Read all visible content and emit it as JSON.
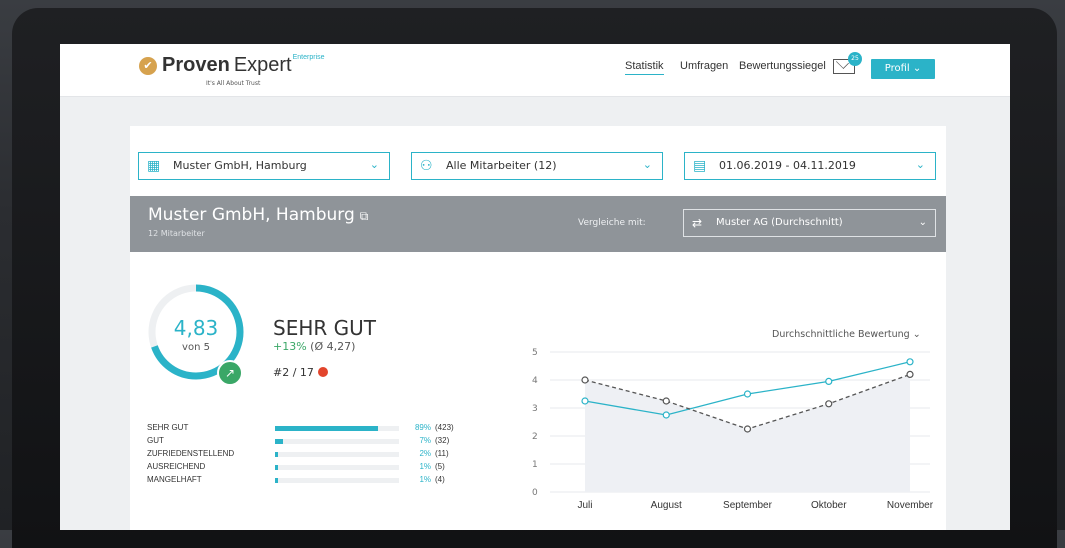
{
  "header": {
    "brand_bold": "Proven",
    "brand_light": "Expert",
    "brand_edition": "Enterprise",
    "tagline": "It's All About Trust",
    "nav": [
      {
        "label": "Statistik",
        "active": true
      },
      {
        "label": "Umfragen",
        "active": false
      },
      {
        "label": "Bewertungssiegel",
        "active": false
      }
    ],
    "mail_badge": "25",
    "profile_label": "Profil"
  },
  "filters": {
    "location": "Muster GmbH, Hamburg",
    "employees": "Alle Mitarbeiter (12)",
    "date_range": "01.06.2019 - 04.11.2019"
  },
  "company_bar": {
    "name": "Muster GmbH, Hamburg",
    "employees": "12 Mitarbeiter",
    "compare_label": "Vergleiche mit:",
    "compare_value": "Muster AG (Durchschnitt)"
  },
  "rating": {
    "value": "4,83",
    "of": "von 5",
    "grade": "SEHR GUT",
    "delta": "+13%",
    "avg": "(Ø 4,27)",
    "rank": "#2 / 17",
    "fraction": 0.966
  },
  "distribution": [
    {
      "label": "SEHR GUT",
      "pct": "89%",
      "count": "(423)",
      "share": 0.89
    },
    {
      "label": "GUT",
      "pct": "7%",
      "count": "(32)",
      "share": 0.07
    },
    {
      "label": "ZUFRIEDENSTELLEND",
      "pct": "2%",
      "count": "(11)",
      "share": 0.02
    },
    {
      "label": "AUSREICHEND",
      "pct": "1%",
      "count": "(5)",
      "share": 0.01
    },
    {
      "label": "MANGELHAFT",
      "pct": "1%",
      "count": "(4)",
      "share": 0.01
    }
  ],
  "chart_title": "Durchschnittliche Bewertung",
  "colors": {
    "accent": "#2bb3c8",
    "positive": "#3aa767",
    "compare": "#555555"
  },
  "chart_data": {
    "type": "line",
    "title": "Durchschnittliche Bewertung",
    "categories": [
      "Juli",
      "August",
      "September",
      "Oktober",
      "November"
    ],
    "series": [
      {
        "values": [
          3.25,
          2.75,
          3.5,
          3.95,
          4.65
        ],
        "style": "solid",
        "color": "#2bb3c8"
      },
      {
        "values": [
          4.0,
          3.25,
          2.25,
          3.15,
          4.2
        ],
        "style": "dashed",
        "color": "#555555"
      }
    ],
    "ylim": [
      0,
      5
    ],
    "yticks": [
      "0",
      "1",
      "2",
      "3",
      "4",
      "5"
    ],
    "grid": true
  }
}
